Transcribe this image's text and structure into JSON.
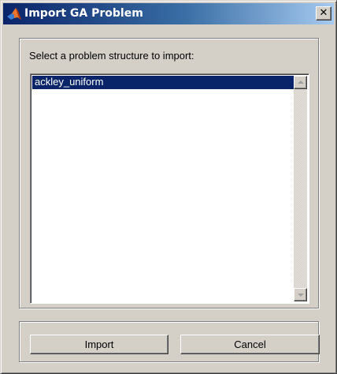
{
  "window": {
    "title": "Import GA Problem",
    "close_glyph": "✕"
  },
  "icons": {
    "title_icon": "matlab-logo-icon",
    "close_icon": "close-icon",
    "scroll_up_icon": "scroll-up-arrow-icon",
    "scroll_down_icon": "scroll-down-arrow-icon"
  },
  "prompt": "Select a problem structure to import:",
  "list": {
    "items": [
      {
        "label": "ackley_uniform",
        "selected": true
      }
    ]
  },
  "buttons": {
    "import_label": "Import",
    "cancel_label": "Cancel"
  },
  "colors": {
    "selection": "#0a246a",
    "titlebar_start": "#0a246a",
    "titlebar_end": "#a6caf0",
    "dialog_face": "#d4d0c8"
  }
}
